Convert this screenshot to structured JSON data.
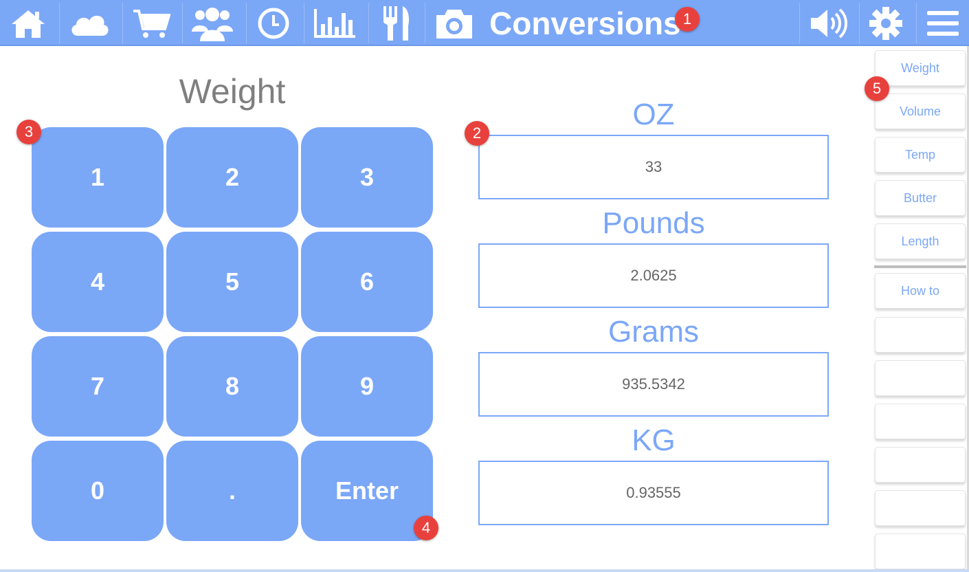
{
  "header": {
    "title": "Conversions",
    "icons": [
      "home-icon",
      "cloud-icon",
      "cart-icon",
      "people-icon",
      "clock-icon",
      "chart-icon",
      "utensils-icon",
      "camera-icon",
      "speaker-icon",
      "gear-icon",
      "menu-icon"
    ]
  },
  "keypad": {
    "title": "Weight",
    "keys": [
      "1",
      "2",
      "3",
      "4",
      "5",
      "6",
      "7",
      "8",
      "9",
      "0",
      ".",
      "Enter"
    ]
  },
  "results": [
    {
      "label": "OZ",
      "value": "33"
    },
    {
      "label": "Pounds",
      "value": "2.0625"
    },
    {
      "label": "Grams",
      "value": "935.5342"
    },
    {
      "label": "KG",
      "value": "0.93555"
    }
  ],
  "sidebar": {
    "items": [
      "Weight",
      "Volume",
      "Temp",
      "Butter",
      "Length",
      "How to",
      "",
      "",
      "",
      "",
      "",
      ""
    ]
  },
  "badges": [
    "1",
    "2",
    "3",
    "4",
    "5"
  ],
  "colors": {
    "accent": "#7ba7f7",
    "badge": "#e8413d",
    "text_gray": "#7f7f7f"
  }
}
